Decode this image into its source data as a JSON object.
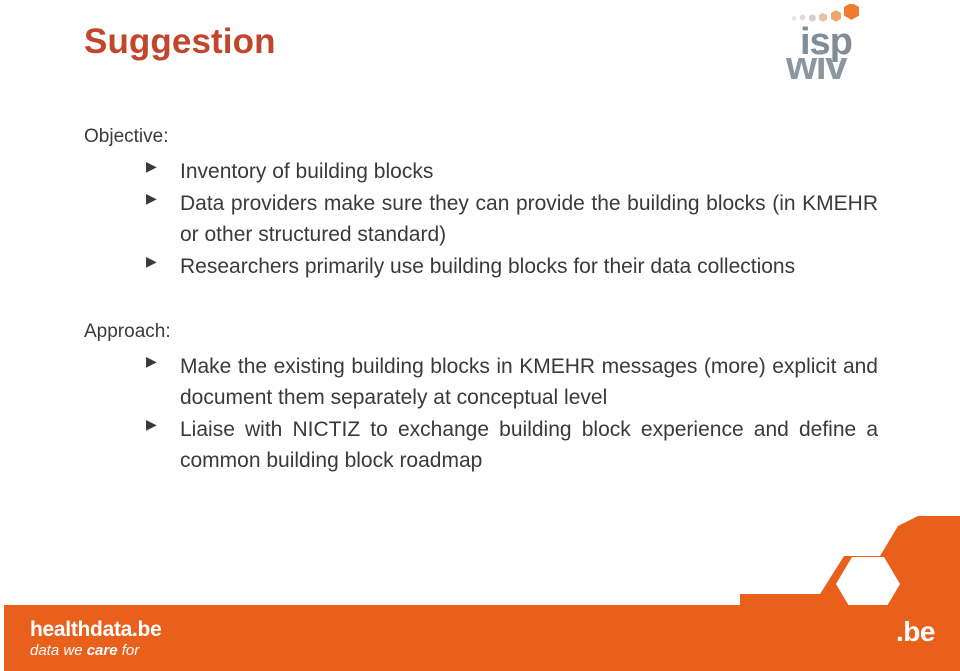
{
  "slide": {
    "title": "Suggestion",
    "title_color": "#C2462B",
    "background_color": "#FFFFFF"
  },
  "logo": {
    "line1": "isp",
    "line2": "wiv",
    "text_color": "#7F8D98",
    "accent_color": "#EE7C2E"
  },
  "sections": [
    {
      "heading": "Objective:",
      "bullets": [
        "Inventory of building blocks",
        "Data providers make sure they can provide the building blocks (in KMEHR or other structured standard)",
        "Researchers primarily use building blocks for their data collections"
      ]
    },
    {
      "heading": "Approach:",
      "bullets": [
        "Make the existing building blocks in KMEHR messages (more) explicit and document them separately at conceptual level",
        "Liaise with NICTIZ to exchange building block experience and define a common building block roadmap"
      ]
    }
  ],
  "bullet_marker": "▶",
  "footer": {
    "brand_main": "healthdata.be",
    "brand_sub_pre": "data we ",
    "brand_sub_bold": "care",
    "brand_sub_post": " for",
    "domain_mark": ".be",
    "background_color": "#E8601C"
  }
}
